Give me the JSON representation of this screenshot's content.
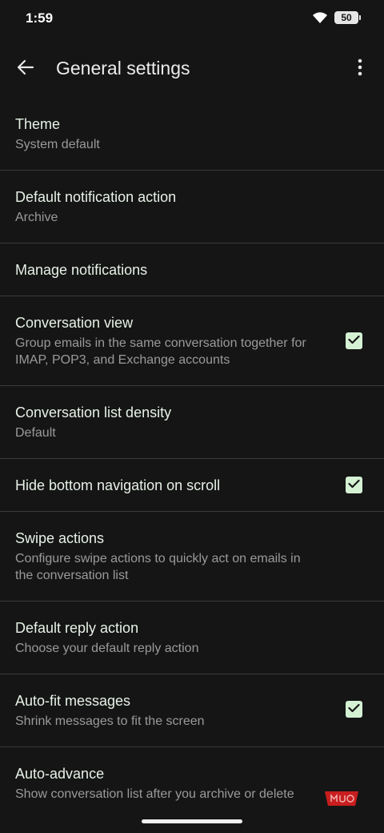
{
  "status_bar": {
    "time": "1:59",
    "battery": "50"
  },
  "app_bar": {
    "title": "General settings"
  },
  "settings": [
    {
      "title": "Theme",
      "subtitle": "System default",
      "checked": null
    },
    {
      "title": "Default notification action",
      "subtitle": "Archive",
      "checked": null
    },
    {
      "title": "Manage notifications",
      "subtitle": null,
      "checked": null
    },
    {
      "title": "Conversation view",
      "subtitle": "Group emails in the same conversation together for IMAP, POP3, and Exchange accounts",
      "checked": true
    },
    {
      "title": "Conversation list density",
      "subtitle": "Default",
      "checked": null
    },
    {
      "title": "Hide bottom navigation on scroll",
      "subtitle": null,
      "checked": true
    },
    {
      "title": "Swipe actions",
      "subtitle": "Configure swipe actions to quickly act on emails in the conversation list",
      "checked": null
    },
    {
      "title": "Default reply action",
      "subtitle": "Choose your default reply action",
      "checked": null
    },
    {
      "title": "Auto-fit messages",
      "subtitle": "Shrink messages to fit the screen",
      "checked": true
    },
    {
      "title": "Auto-advance",
      "subtitle": "Show conversation list after you archive or delete",
      "checked": null
    }
  ],
  "watermark": {
    "text": "MUO"
  },
  "colors": {
    "background": "#151515",
    "checkbox": "#d4f1d4",
    "divider": "#3a3a3a"
  }
}
